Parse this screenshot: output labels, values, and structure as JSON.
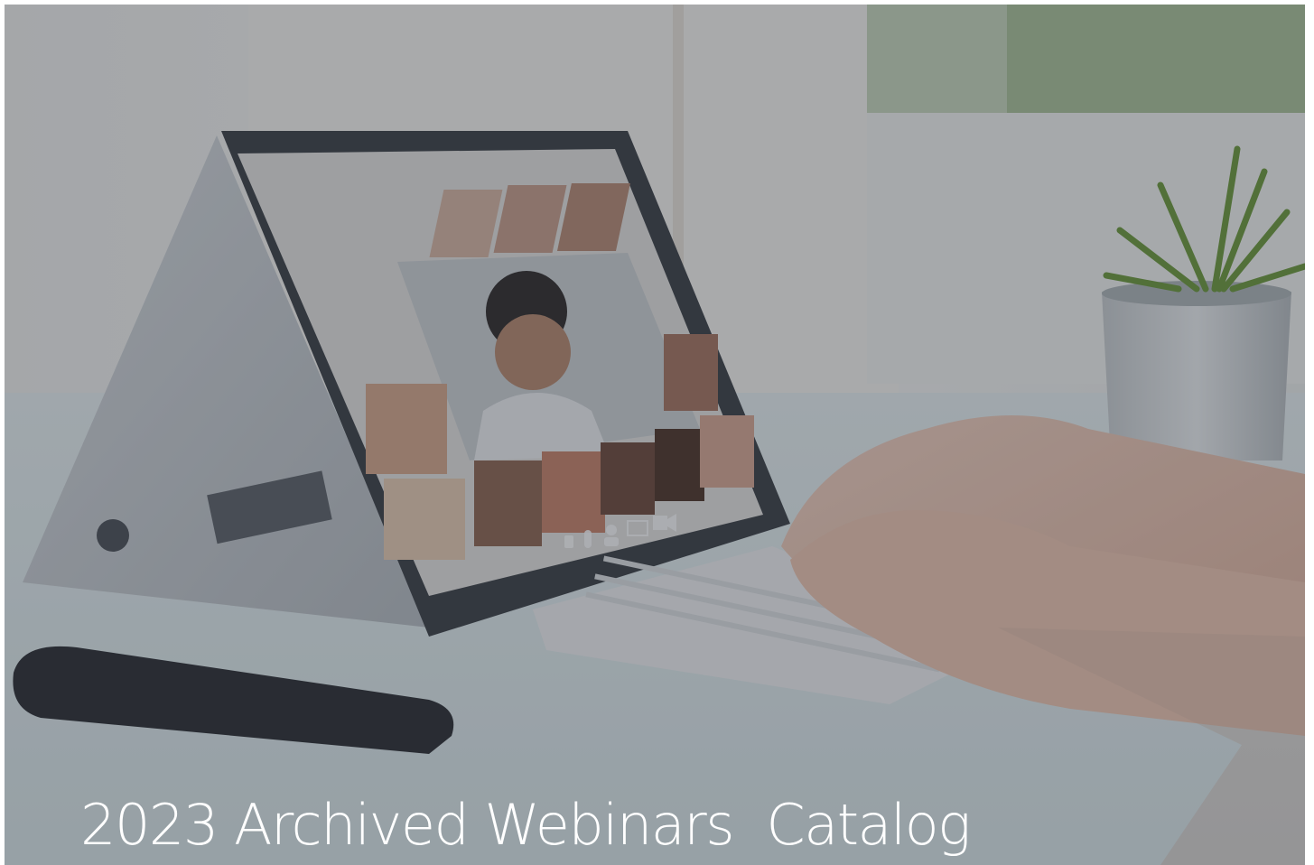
{
  "hero": {
    "title": "2023 Archived Webinars  Catalog",
    "overlay_color": "#282d37",
    "text_color": "#ffffff"
  },
  "photo": {
    "call_controls": [
      "speaker-icon",
      "microphone-icon",
      "participant-icon",
      "screen-share-icon",
      "video-camera-icon"
    ]
  }
}
